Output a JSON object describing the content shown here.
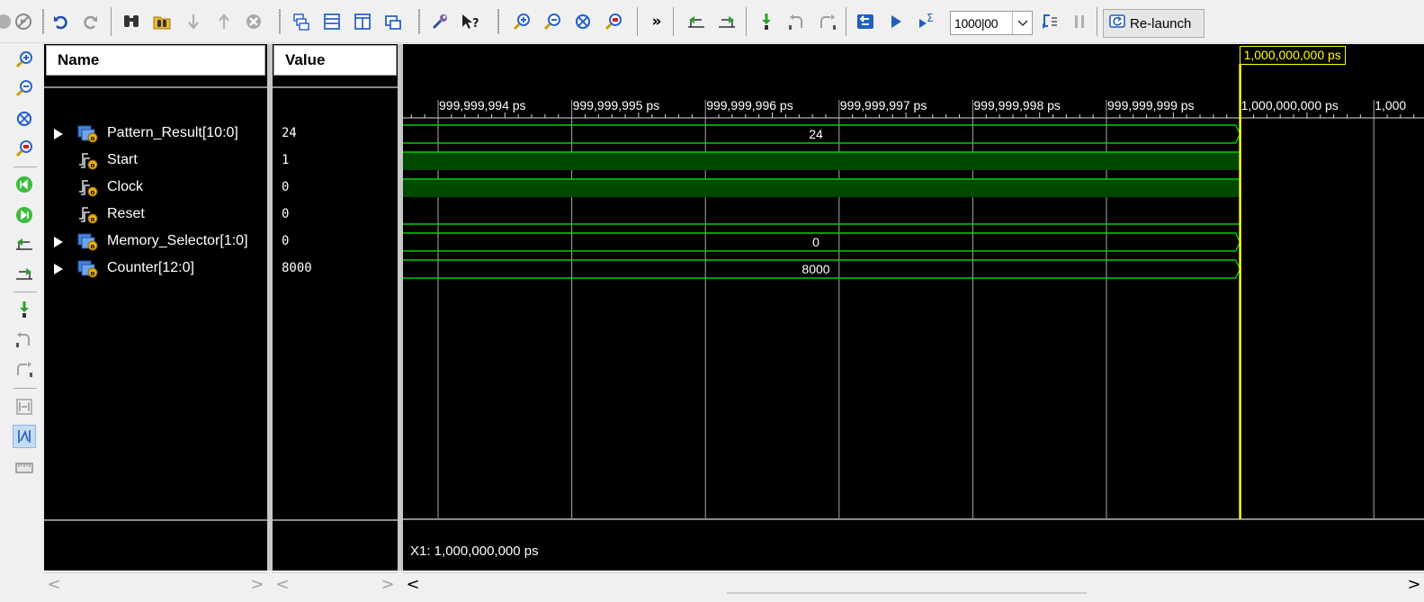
{
  "toolbar": {
    "time_value": "1000|00",
    "relaunch_label": "Re-launch",
    "more_label": "»"
  },
  "columns": {
    "name_header": "Name",
    "value_header": "Value"
  },
  "signals": [
    {
      "name": "Pattern_Result[10:0]",
      "value": "24",
      "type": "bus",
      "icon": "bus-signal-icon",
      "expandable": true
    },
    {
      "name": "Start",
      "value": "1",
      "type": "bit-high",
      "icon": "bit-signal-icon",
      "expandable": false
    },
    {
      "name": "Clock",
      "value": "0",
      "type": "bit-clock",
      "icon": "bit-signal-icon",
      "expandable": false
    },
    {
      "name": "Reset",
      "value": "0",
      "type": "bit-low",
      "icon": "bit-signal-icon",
      "expandable": false
    },
    {
      "name": "Memory_Selector[1:0]",
      "value": "0",
      "type": "bus",
      "icon": "bus-signal-icon",
      "expandable": true
    },
    {
      "name": "Counter[12:0]",
      "value": "8000",
      "type": "bus",
      "icon": "bus-signal-icon",
      "expandable": true
    }
  ],
  "wave": {
    "ticks": [
      "999,999,994 ps",
      "999,999,995 ps",
      "999,999,996 ps",
      "999,999,997 ps",
      "999,999,998 ps",
      "999,999,999 ps",
      "1,000,000,000 ps",
      "1,000"
    ],
    "bus_values": [
      "24",
      "0",
      "8000"
    ],
    "cursor_label": "1,000,000,000 ps",
    "cursor_readout": "X1: 1,000,000,000 ps",
    "colors": {
      "wave": "#00d000",
      "fill": "#004a00",
      "cursor": "#ffff00",
      "grid": "#a8a8a8"
    }
  },
  "scroll": {
    "left": "<",
    "right": ">"
  }
}
